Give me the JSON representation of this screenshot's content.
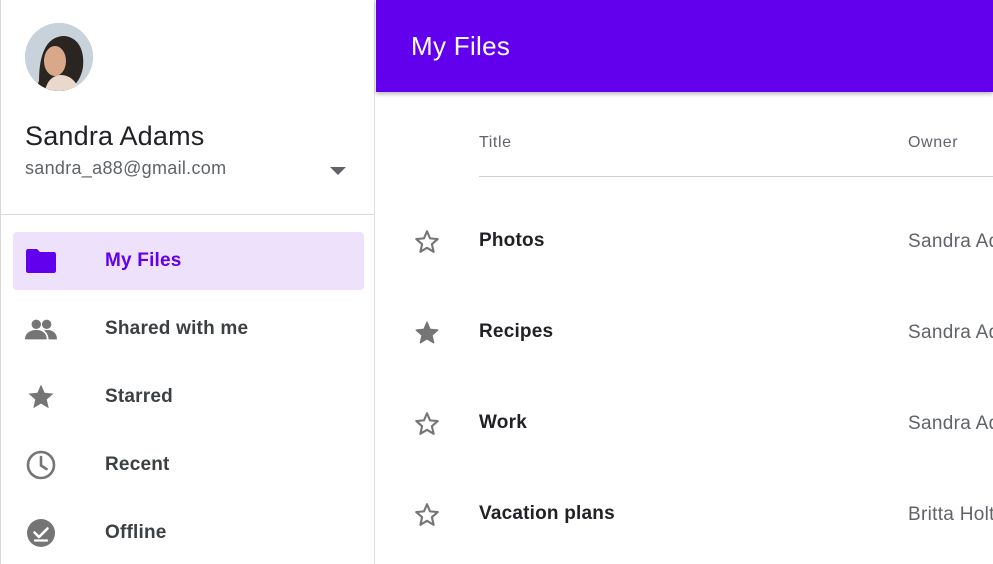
{
  "user": {
    "name": "Sandra Adams",
    "email": "sandra_a88@gmail.com"
  },
  "nav": {
    "items": [
      {
        "label": "My Files",
        "icon": "folder-icon",
        "active": true
      },
      {
        "label": "Shared with me",
        "icon": "people-icon",
        "active": false
      },
      {
        "label": "Starred",
        "icon": "star-icon",
        "active": false
      },
      {
        "label": "Recent",
        "icon": "clock-icon",
        "active": false
      },
      {
        "label": "Offline",
        "icon": "offline-check-icon",
        "active": false
      }
    ]
  },
  "appbar": {
    "title": "My Files"
  },
  "table": {
    "columns": {
      "title": "Title",
      "owner": "Owner"
    },
    "rows": [
      {
        "title": "Photos",
        "owner": "Sandra Adams",
        "starred": false
      },
      {
        "title": "Recipes",
        "owner": "Sandra Adams",
        "starred": true
      },
      {
        "title": "Work",
        "owner": "Sandra Adams",
        "starred": false
      },
      {
        "title": "Vacation plans",
        "owner": "Britta Holt",
        "starred": false
      }
    ]
  },
  "colors": {
    "primary": "#6200ee",
    "active_bg": "#ede1fb",
    "icon_gray": "#757575"
  }
}
